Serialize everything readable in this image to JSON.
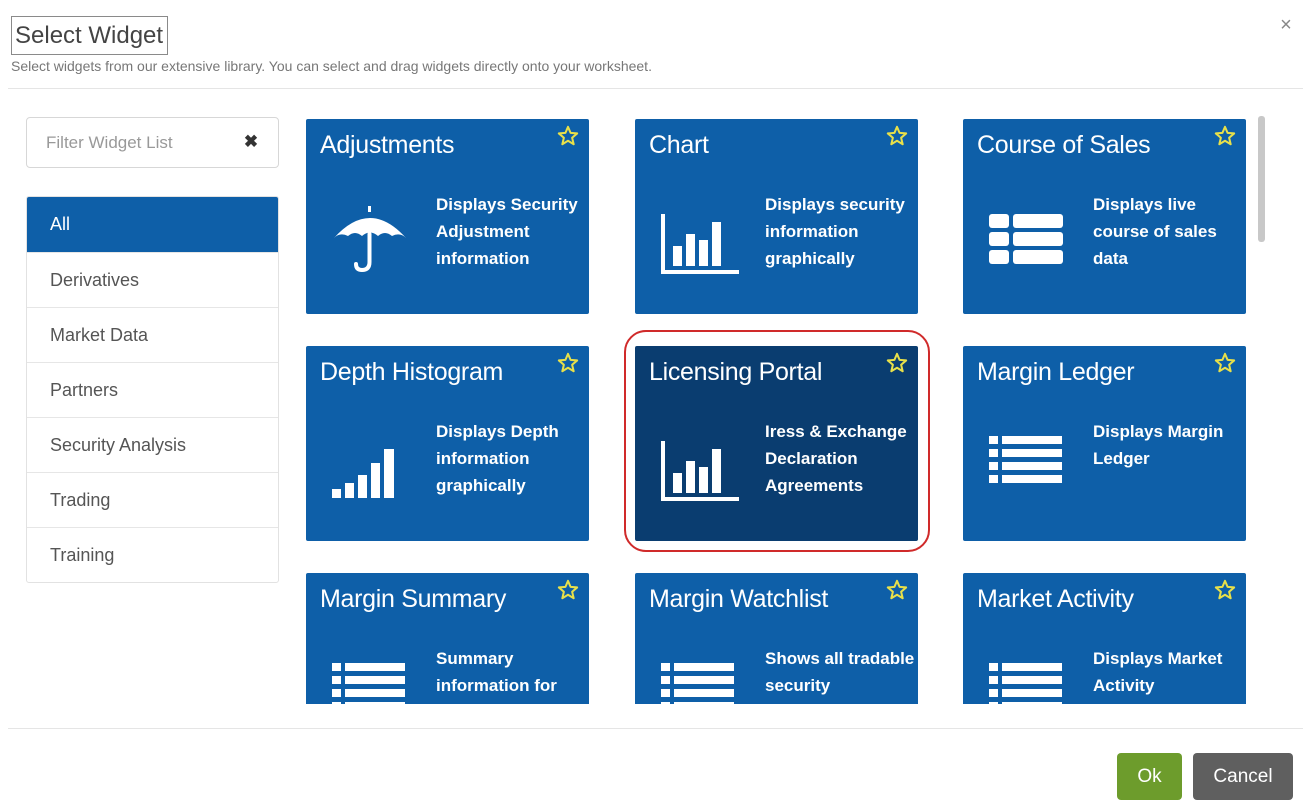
{
  "dialog": {
    "title": "Select Widget",
    "subtitle": "Select widgets from our extensive library. You can select and drag widgets directly onto your worksheet.",
    "close_glyph": "×"
  },
  "filter": {
    "placeholder": "Filter Widget List",
    "clear_glyph": "✖"
  },
  "categories": [
    {
      "label": "All",
      "active": true
    },
    {
      "label": "Derivatives",
      "active": false
    },
    {
      "label": "Market Data",
      "active": false
    },
    {
      "label": "Partners",
      "active": false
    },
    {
      "label": "Security Analysis",
      "active": false
    },
    {
      "label": "Trading",
      "active": false
    },
    {
      "label": "Training",
      "active": false
    }
  ],
  "widgets": [
    {
      "title": "Adjustments",
      "description": "Displays Security Adjustment information",
      "icon": "umbrella-icon"
    },
    {
      "title": "Chart",
      "description": "Displays security information graphically",
      "icon": "bar-chart-icon"
    },
    {
      "title": "Course of Sales",
      "description": "Displays live course of sales data",
      "icon": "stacked-list-icon"
    },
    {
      "title": "Depth Histogram",
      "description": "Displays Depth information graphically",
      "icon": "signal-bars-icon"
    },
    {
      "title": "Licensing Portal",
      "description": "Iress & Exchange Declaration Agreements",
      "icon": "bar-chart-icon",
      "selected": true
    },
    {
      "title": "Margin Ledger",
      "description": "Displays Margin Ledger",
      "icon": "list-icon"
    },
    {
      "title": "Margin Summary",
      "description": "Summary information for",
      "icon": "list-icon"
    },
    {
      "title": "Margin Watchlist",
      "description": "Shows all tradable security",
      "icon": "list-icon"
    },
    {
      "title": "Market Activity",
      "description": "Displays Market Activity",
      "icon": "list-icon"
    }
  ],
  "footer": {
    "ok_label": "Ok",
    "cancel_label": "Cancel"
  },
  "colors": {
    "tile": "#0e5fa8",
    "tile_selected": "#0a3d70",
    "star": "#e8e04a",
    "highlight": "#d02a2a",
    "ok": "#6d9c2c",
    "cancel": "#5f5f5f"
  }
}
